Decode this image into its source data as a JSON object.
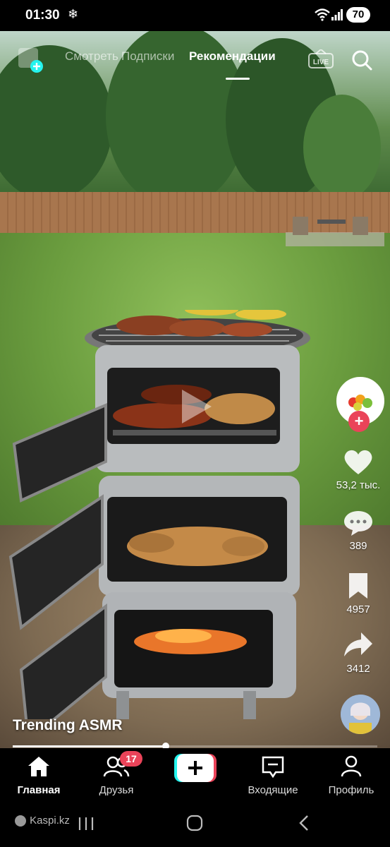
{
  "status_bar": {
    "time": "01:30",
    "battery": "70"
  },
  "top_nav": {
    "tabs": [
      {
        "label": "Смотреть",
        "active": false
      },
      {
        "label": "Подписки",
        "active": false
      },
      {
        "label": "Рекомендации",
        "active": true
      }
    ],
    "live_label": "LIVE"
  },
  "actions": {
    "likes": "53,2 тыс.",
    "comments": "389",
    "saves": "4957",
    "shares": "3412"
  },
  "video": {
    "caption": "Trending ASMR",
    "progress": 0.42
  },
  "bottom_nav": {
    "home": "Главная",
    "friends": "Друзья",
    "friends_badge": "17",
    "inbox": "Входящие",
    "profile": "Профиль"
  },
  "system_nav": {
    "ad_text": "Kaspi.kz"
  },
  "colors": {
    "accent_red": "#ea4359",
    "accent_cyan": "#25f4ee"
  }
}
